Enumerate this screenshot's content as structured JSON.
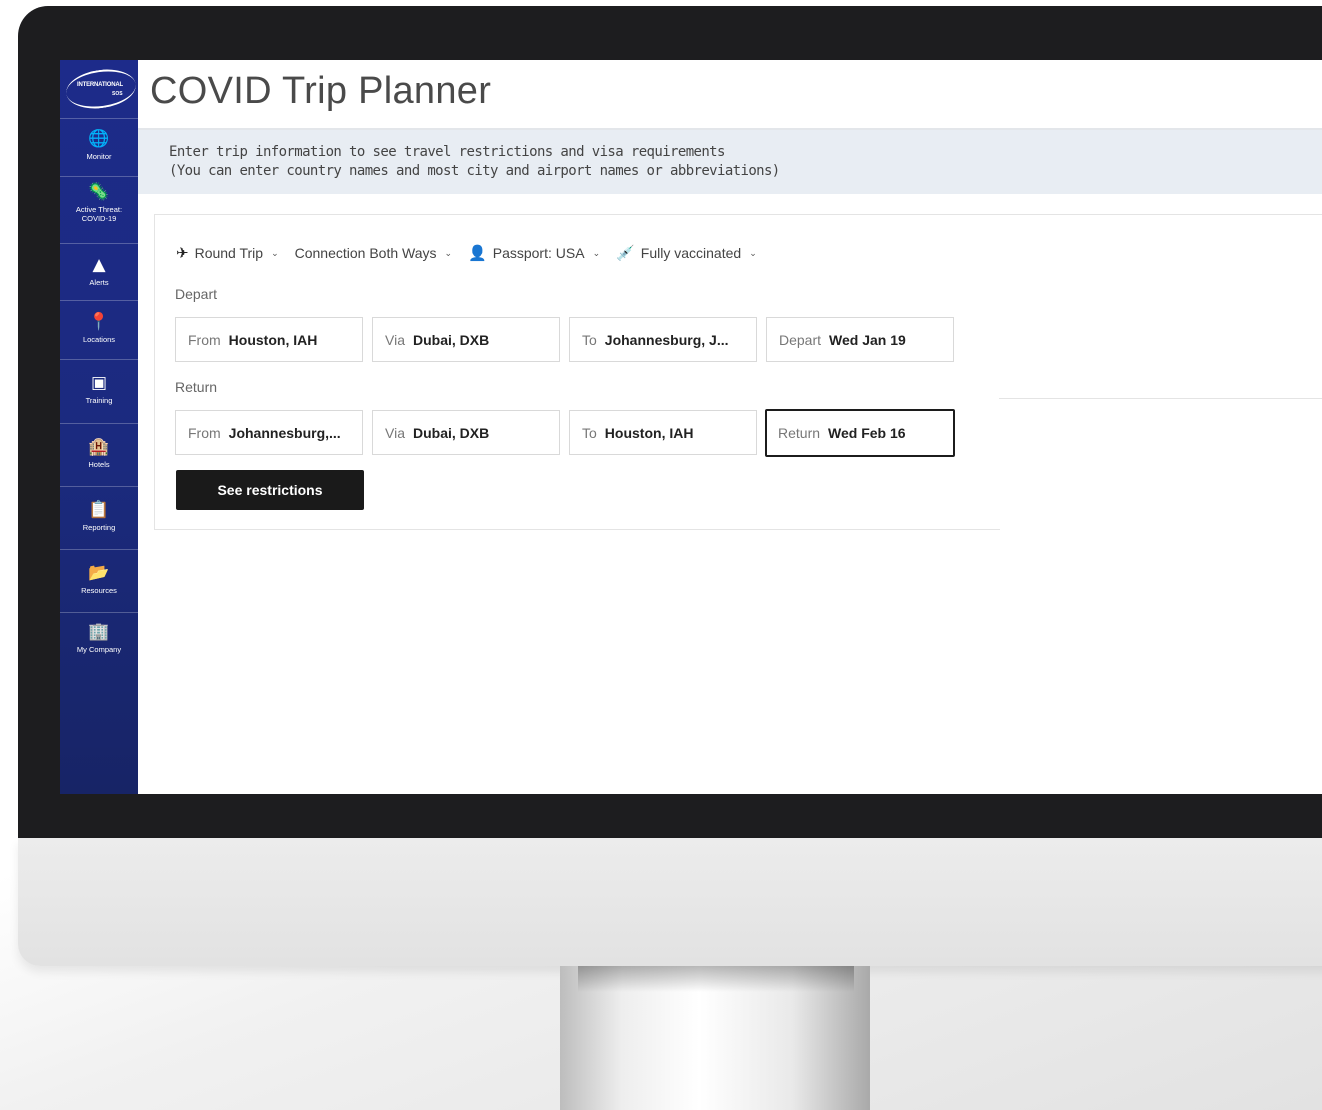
{
  "app": {
    "title": "COVID Trip Planner"
  },
  "logo": {
    "text": "INTERNATIONAL",
    "sub": "SOS"
  },
  "sidebar": {
    "items": [
      {
        "label": "Monitor",
        "icon": "globe-icon",
        "glyph": "🌐"
      },
      {
        "label": "Active Threat: COVID-19",
        "icon": "virus-globe-icon",
        "glyph": "🦠"
      },
      {
        "label": "Alerts",
        "icon": "warning-icon",
        "glyph": "▲"
      },
      {
        "label": "Locations",
        "icon": "location-pin-icon",
        "glyph": "📍"
      },
      {
        "label": "Training",
        "icon": "training-icon",
        "glyph": "▣"
      },
      {
        "label": "Hotels",
        "icon": "hotel-icon",
        "glyph": "🏨"
      },
      {
        "label": "Reporting",
        "icon": "report-icon",
        "glyph": "📋"
      },
      {
        "label": "Resources",
        "icon": "folder-icon",
        "glyph": "📂"
      },
      {
        "label": "My Company",
        "icon": "building-icon",
        "glyph": "🏢"
      }
    ]
  },
  "info": {
    "line1": "Enter trip information to see travel restrictions and visa requirements",
    "line2": "(You can enter country names and most city and airport names or abbreviations)"
  },
  "options": {
    "trip_type": "Round Trip",
    "connection": "Connection Both Ways",
    "passport": "Passport: USA",
    "vaccination": "Fully vaccinated"
  },
  "depart": {
    "section_label": "Depart",
    "from": {
      "label": "From",
      "value": "Houston, IAH"
    },
    "via": {
      "label": "Via",
      "value": "Dubai, DXB"
    },
    "to": {
      "label": "To",
      "value": "Johannesburg, J..."
    },
    "date": {
      "label": "Depart",
      "value": "Wed Jan 19"
    }
  },
  "return": {
    "section_label": "Return",
    "from": {
      "label": "From",
      "value": "Johannesburg,..."
    },
    "via": {
      "label": "Via",
      "value": "Dubai, DXB"
    },
    "to": {
      "label": "To",
      "value": "Houston, IAH"
    },
    "date": {
      "label": "Return",
      "value": "Wed Feb 16"
    }
  },
  "actions": {
    "submit_label": "See restrictions"
  },
  "colors": {
    "sidebar": "#1d2b8a",
    "button": "#1a1a1a",
    "info_bg": "#e8edf3",
    "bezel": "#1d1d1f"
  }
}
